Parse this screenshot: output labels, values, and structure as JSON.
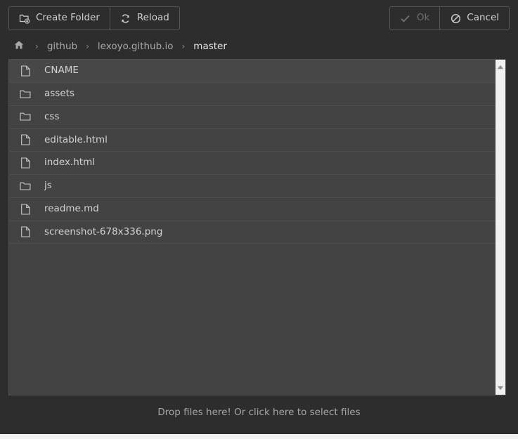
{
  "colors": {
    "window_bg": "#2d2d2d",
    "panel_bg": "#434343",
    "border": "#555555",
    "text": "#cfcfcf",
    "text_muted": "#a8a8a8",
    "text_disabled": "#6d6d6d",
    "scrollbar_track": "#f0f0f0"
  },
  "toolbar": {
    "left_buttons": [
      {
        "label": "Create Folder",
        "icon": "folder-plus-icon",
        "disabled": false
      },
      {
        "label": "Reload",
        "icon": "refresh-icon",
        "disabled": false
      }
    ],
    "right_buttons": [
      {
        "label": "Ok",
        "icon": "check-icon",
        "disabled": true
      },
      {
        "label": "Cancel",
        "icon": "ban-icon",
        "disabled": false
      }
    ]
  },
  "breadcrumb": {
    "home_icon": "home-icon",
    "separator": "›",
    "items": [
      {
        "label": "github",
        "active": false
      },
      {
        "label": "lexoyo.github.io",
        "active": false
      },
      {
        "label": "master",
        "active": true
      }
    ]
  },
  "filelist": {
    "rows": [
      {
        "name": "CNAME",
        "type": "file"
      },
      {
        "name": "assets",
        "type": "folder"
      },
      {
        "name": "css",
        "type": "folder"
      },
      {
        "name": "editable.html",
        "type": "file"
      },
      {
        "name": "index.html",
        "type": "file"
      },
      {
        "name": "js",
        "type": "folder"
      },
      {
        "name": "readme.md",
        "type": "file"
      },
      {
        "name": "screenshot-678x336.png",
        "type": "file"
      }
    ]
  },
  "scrollbar": {
    "up_arrow_icon": "triangle-up-icon",
    "down_arrow_icon": "triangle-down-icon"
  },
  "dropzone": {
    "text": "Drop files here! Or click here to select files"
  }
}
